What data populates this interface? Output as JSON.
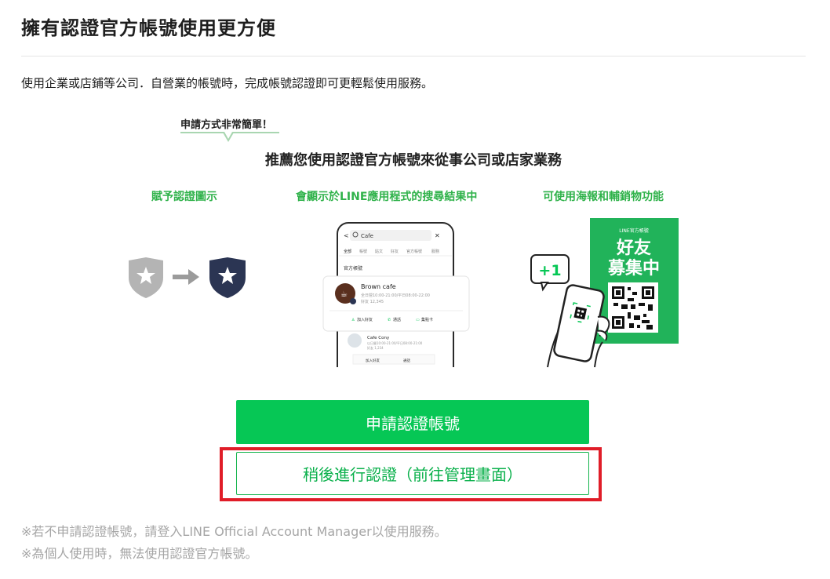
{
  "page": {
    "title": "擁有認證官方帳號使用更方便",
    "description": "使用企業或店鋪等公司．自營業的帳號時，完成帳號認證即可更輕鬆使用服務。"
  },
  "illustration": {
    "bubble": "申請方式非常簡單！",
    "headline": "推薦您使用認證官方帳號來從事公司或店家業務",
    "features": [
      "賦予認證圖示",
      "會顯示於LINE應用程式的搜尋結果中",
      "可使用海報和輔銷物功能"
    ],
    "phone": {
      "search_text": "Cafe",
      "tabs": [
        "全部",
        "帳號",
        "貼文",
        "好友",
        "官方帳號",
        "服務"
      ],
      "section_label": "官方帳號",
      "card": {
        "name": "Brown cafe",
        "hours": "全日營10:00-21:00/平日08:00-22:00",
        "friends": "好友 12,345",
        "actions": [
          "加入好友",
          "通話",
          "集點卡"
        ]
      },
      "card2": {
        "name": "Cafe Cony",
        "hours": "以日營10:00-21:00/平日08:00-21:00",
        "friends": "好友 1,234",
        "actions": [
          "加入好友",
          "通話"
        ]
      }
    },
    "poster": {
      "badge_plus": "+1",
      "header": "LINE官方帳號",
      "line1": "好友",
      "line2": "募集中"
    }
  },
  "buttons": {
    "apply": "申請認證帳號",
    "later": "稍後進行認證（前往管理畫面）"
  },
  "notes": {
    "note1": "※若不申請認證帳號，請登入LINE Official Account Manager以使用服務。",
    "note2": "※為個人使用時，無法使用認證官方帳號。"
  },
  "colors": {
    "brand_green": "#06c755",
    "feature_green": "#2fb24a",
    "highlight_red": "#e01d28",
    "note_gray": "#a5a5a5",
    "shield_dark": "#2b3553",
    "shield_gray": "#b4b4b4"
  }
}
